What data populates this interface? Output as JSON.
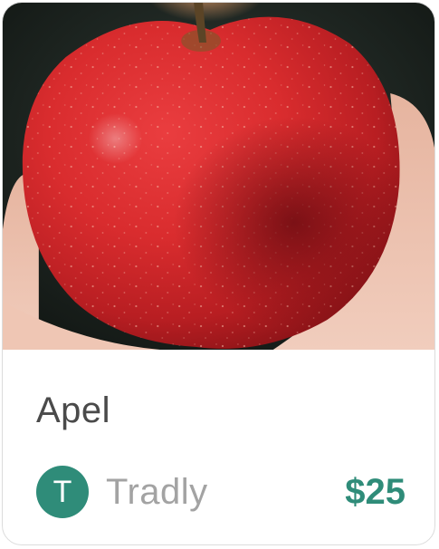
{
  "product": {
    "name": "Apel",
    "image_subject": "apple-photo",
    "price": "$25"
  },
  "seller": {
    "initial": "T",
    "name": "Tradly"
  },
  "colors": {
    "accent": "#2f8c79",
    "title_text": "#4a4a4a",
    "muted_text": "#a3a3a3"
  }
}
